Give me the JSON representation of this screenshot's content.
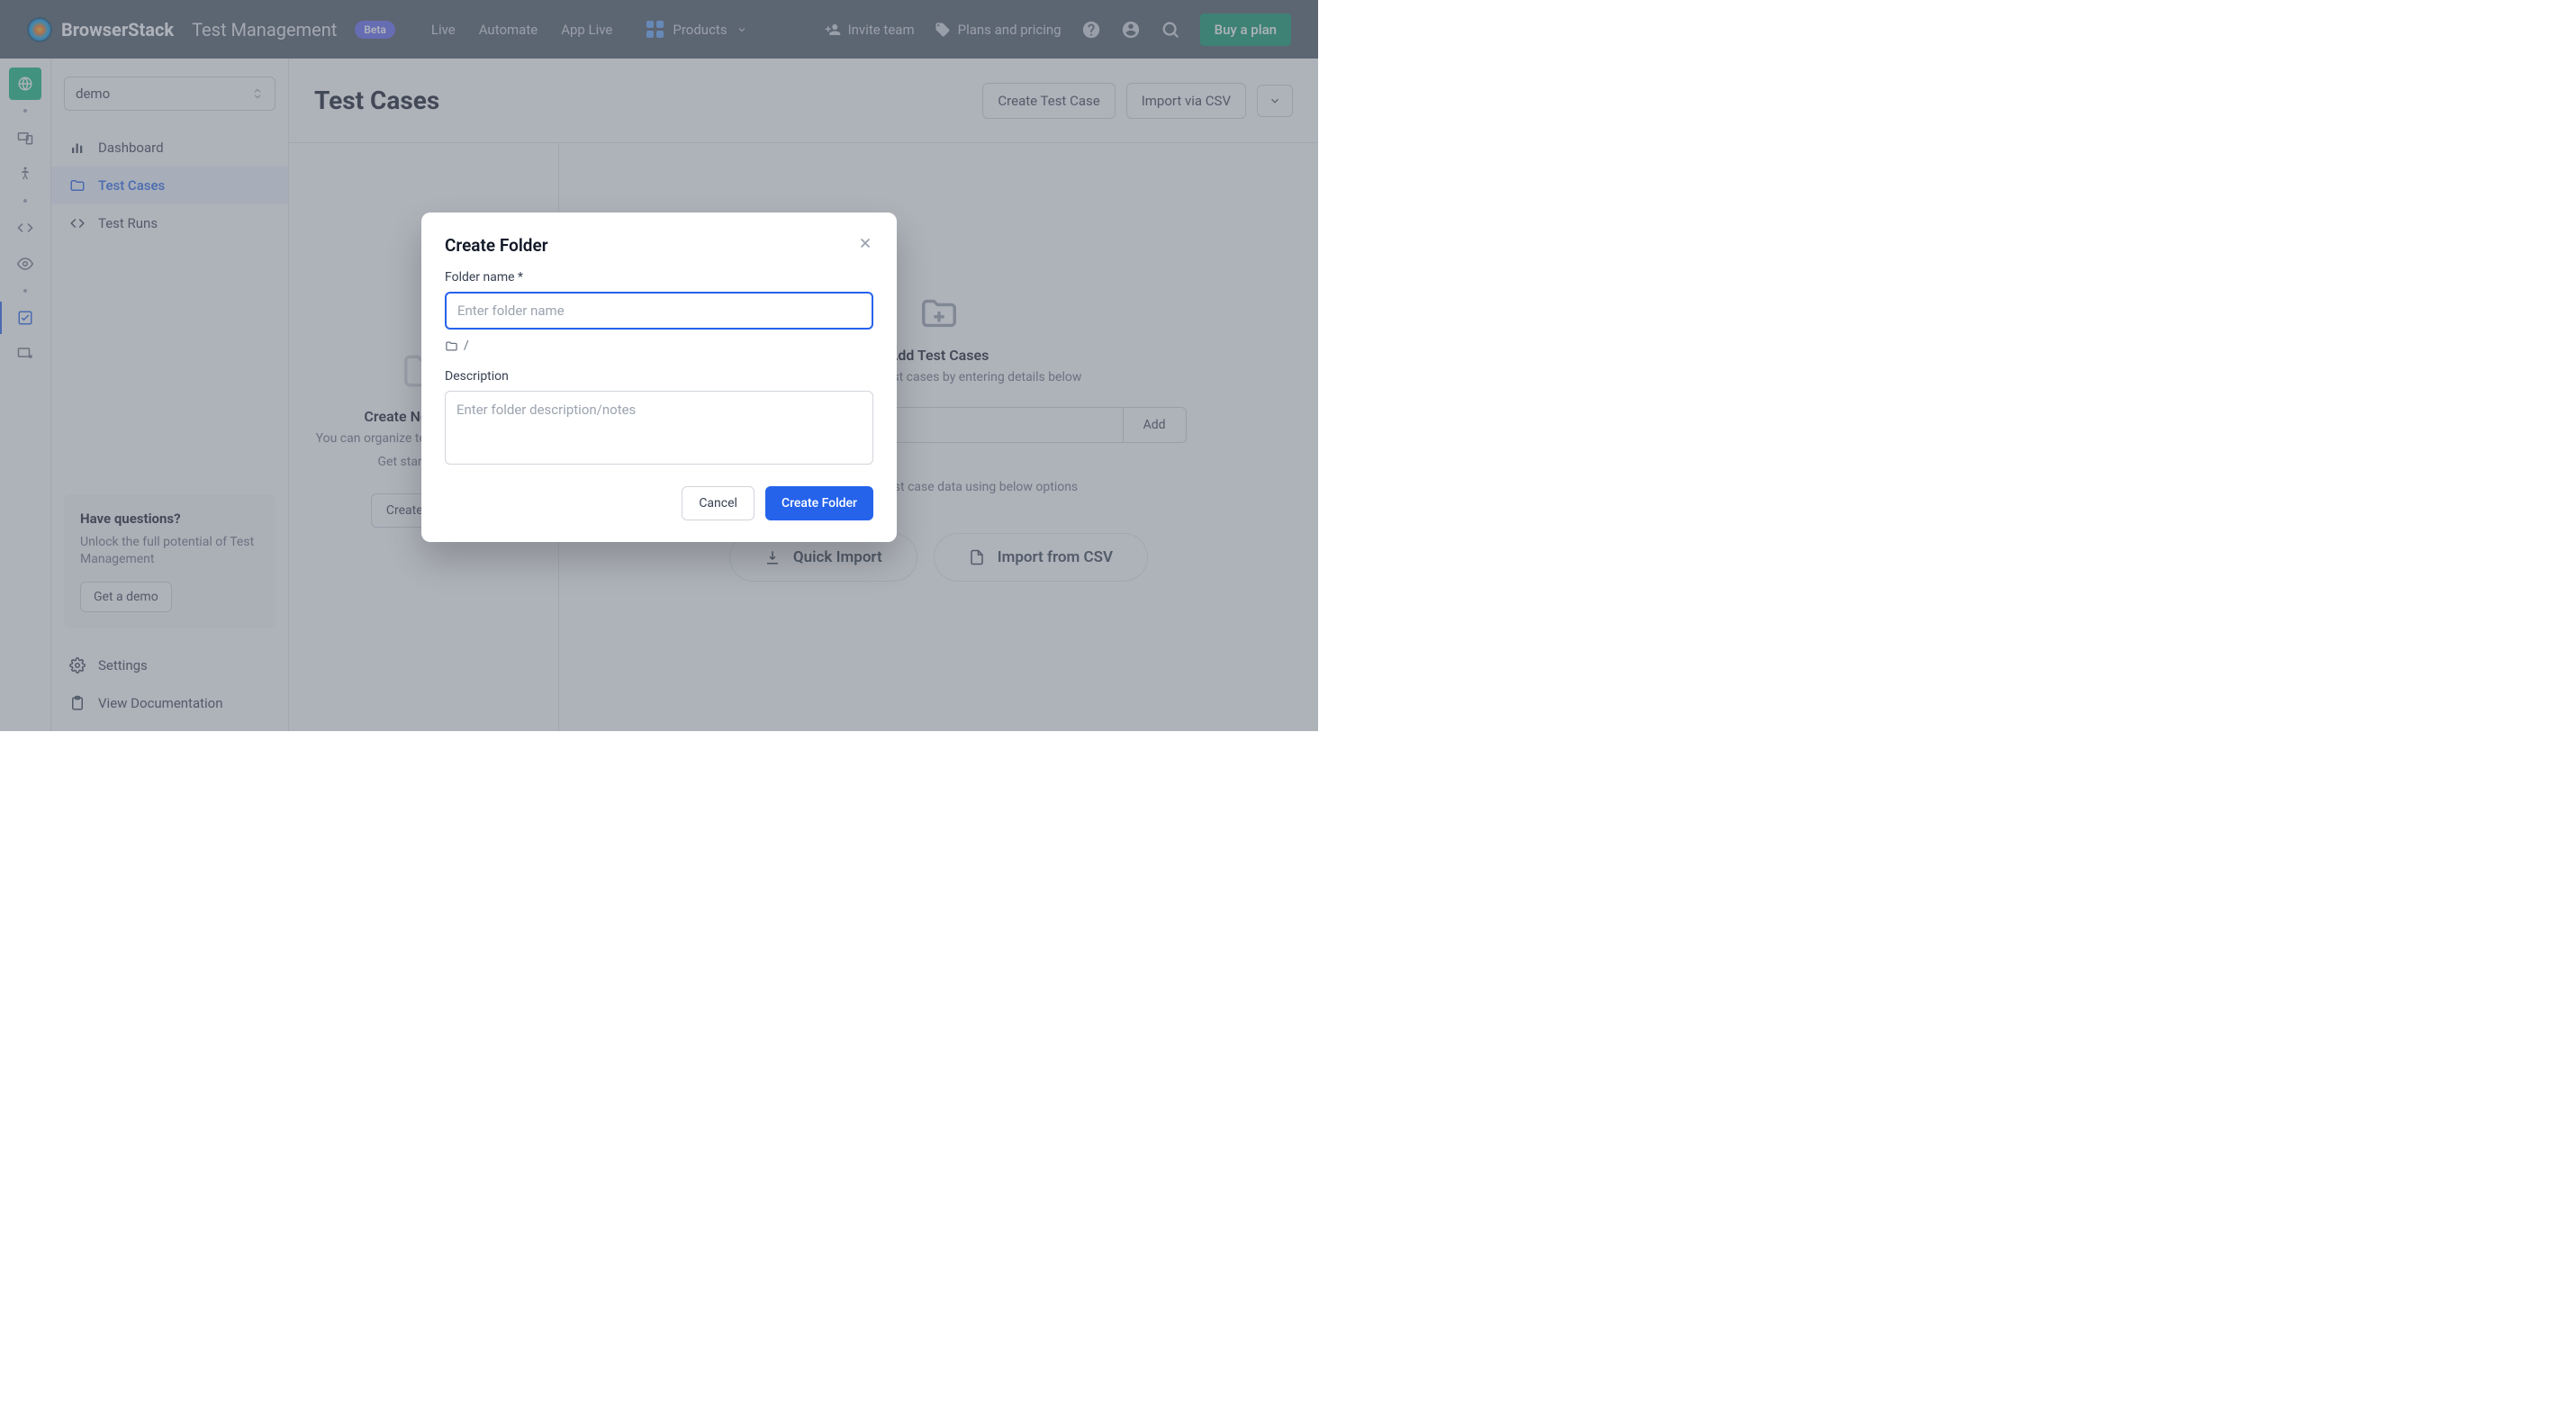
{
  "topbar": {
    "brand": "BrowserStack",
    "product": "Test Management",
    "beta": "Beta",
    "nav": {
      "live": "Live",
      "automate": "Automate",
      "app_live": "App Live"
    },
    "products_label": "Products",
    "invite": "Invite team",
    "plans": "Plans and pricing",
    "buy": "Buy a plan"
  },
  "sidebar": {
    "project": "demo",
    "items": {
      "dashboard": "Dashboard",
      "test_cases": "Test Cases",
      "test_runs": "Test Runs",
      "settings": "Settings",
      "docs": "View Documentation"
    },
    "help": {
      "title": "Have questions?",
      "body": "Unlock the full potential of Test Management",
      "cta": "Get a demo"
    }
  },
  "page": {
    "title": "Test Cases",
    "create_btn": "Create Test Case",
    "import_btn": "Import via CSV"
  },
  "left_pane": {
    "title": "Create New Folder",
    "line1": "You can organize test cases in folders.",
    "line2": "Get started now.",
    "cta": "Create Folder"
  },
  "right_pane": {
    "title": "Add Test Cases",
    "subtitle": "You can create test cases by entering details below",
    "add_btn": "Add",
    "import_hint": "Or import your test case data using below options",
    "quick": "Quick Import",
    "csv": "Import from CSV"
  },
  "modal": {
    "title": "Create Folder",
    "name_label": "Folder name *",
    "name_placeholder": "Enter folder name",
    "path": "/",
    "desc_label": "Description",
    "desc_placeholder": "Enter folder description/notes",
    "cancel": "Cancel",
    "submit": "Create Folder"
  }
}
